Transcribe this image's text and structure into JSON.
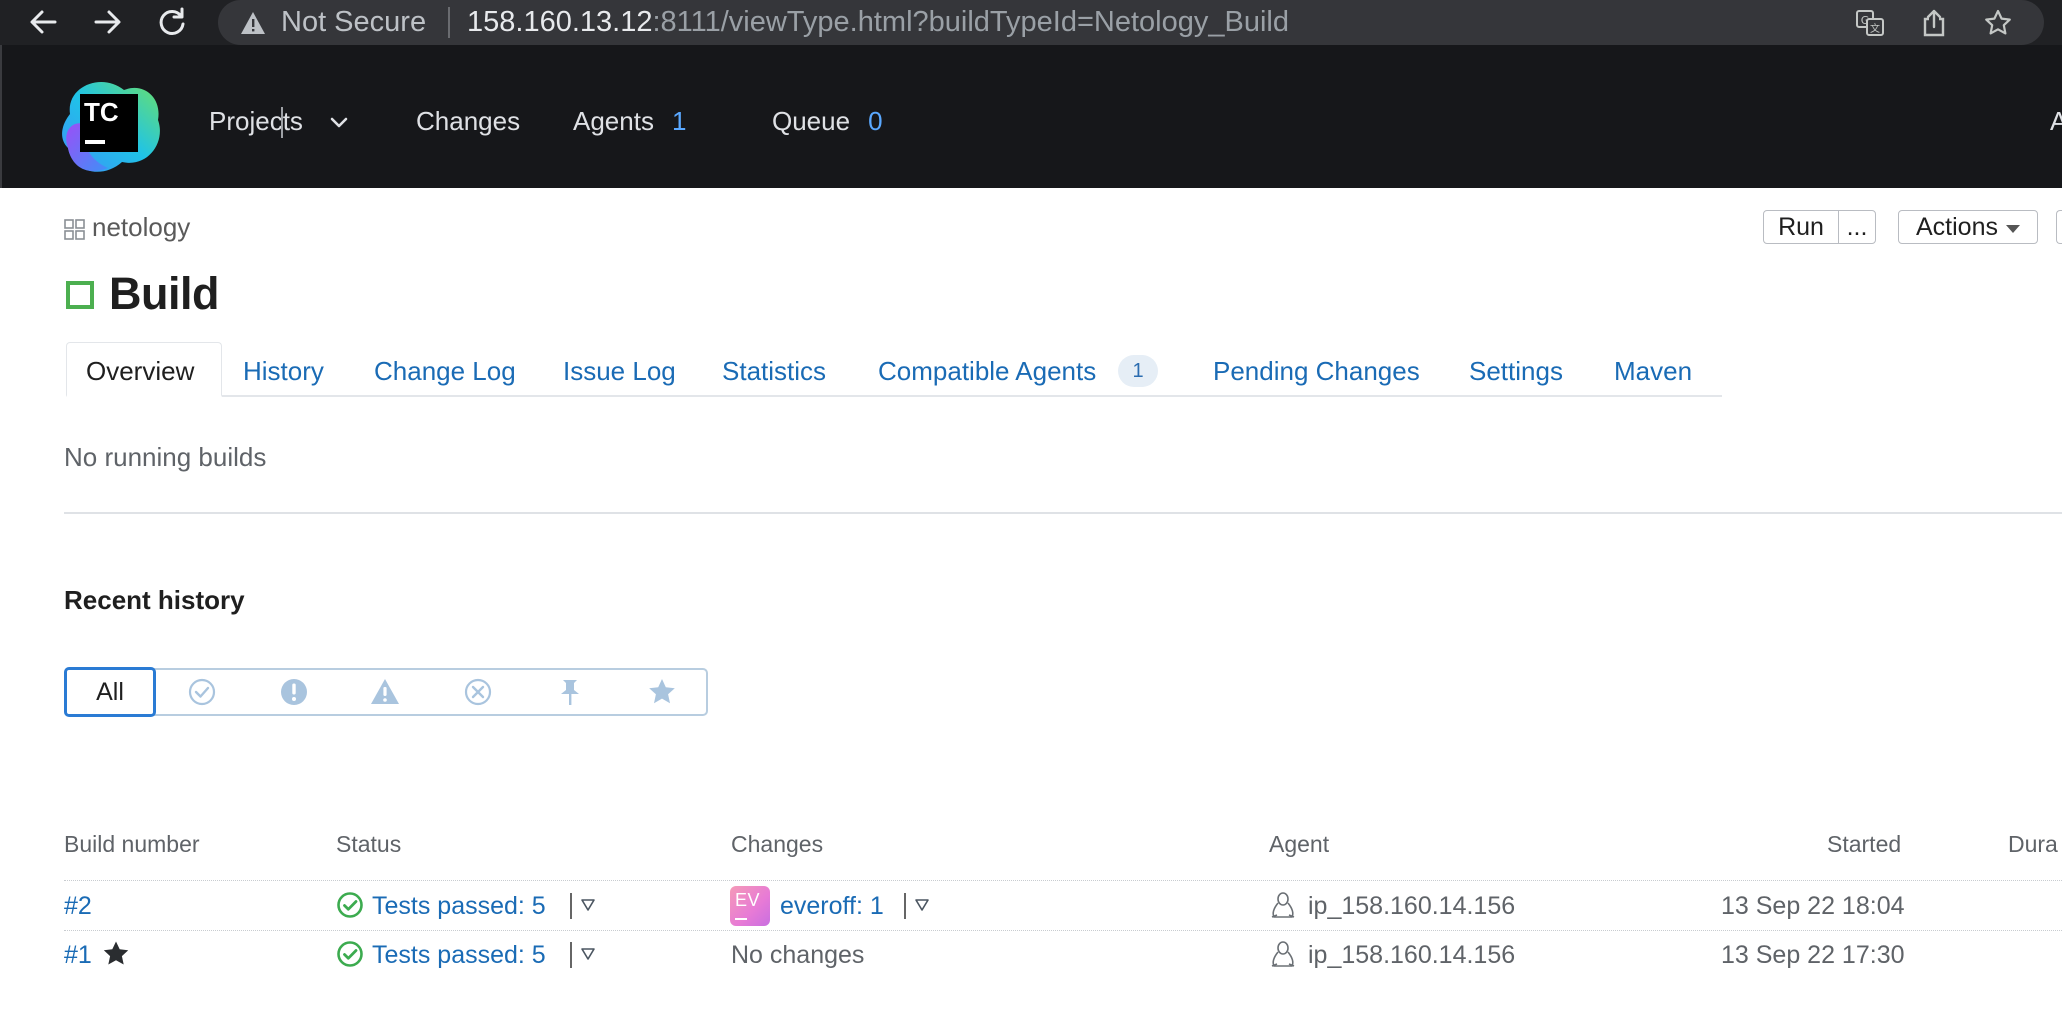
{
  "browser": {
    "security_label": "Not Secure",
    "url_host": "158.160.13.12",
    "url_rest": ":8111/viewType.html?buildTypeId=Netology_Build"
  },
  "header": {
    "logo_text": "TC",
    "nav": [
      {
        "label": "Projects"
      },
      {
        "label": "Changes"
      },
      {
        "label": "Agents",
        "count": "1"
      },
      {
        "label": "Queue",
        "count": "0"
      }
    ],
    "right_cut_text": "A"
  },
  "breadcrumb": "netology",
  "toolbar": {
    "run_label": "Run",
    "more_label": "...",
    "actions_label": "Actions"
  },
  "page_title": "Build",
  "tabs": [
    {
      "label": "Overview",
      "active": true
    },
    {
      "label": "History"
    },
    {
      "label": "Change Log"
    },
    {
      "label": "Issue Log"
    },
    {
      "label": "Statistics"
    },
    {
      "label": "Compatible Agents",
      "badge": "1"
    },
    {
      "label": "Pending Changes"
    },
    {
      "label": "Settings"
    },
    {
      "label": "Maven"
    }
  ],
  "running_text": "No running builds",
  "recent_history": {
    "title": "Recent history",
    "filter_all": "All",
    "filters": [
      "successful-icon",
      "failed-icon",
      "warning-icon",
      "cancelled-icon",
      "pinned-icon",
      "starred-icon"
    ]
  },
  "table": {
    "headers": [
      "Build number",
      "Status",
      "Changes",
      "Agent",
      "Started",
      "Dura"
    ],
    "rows": [
      {
        "build": "#2",
        "status": "Tests passed: 5",
        "avatar": "EV",
        "changes": "everoff: 1",
        "agent": "ip_158.160.14.156",
        "started": "13 Sep 22 18:04",
        "starred": false
      },
      {
        "build": "#1",
        "status": "Tests passed: 5",
        "changes": "No changes",
        "agent": "ip_158.160.14.156",
        "started": "13 Sep 22 17:30",
        "starred": true
      }
    ]
  },
  "colors": {
    "link": "#1a6bb5",
    "success": "#4caf50",
    "header_bg": "#16171a",
    "filter_active": "#2a7bd4"
  }
}
